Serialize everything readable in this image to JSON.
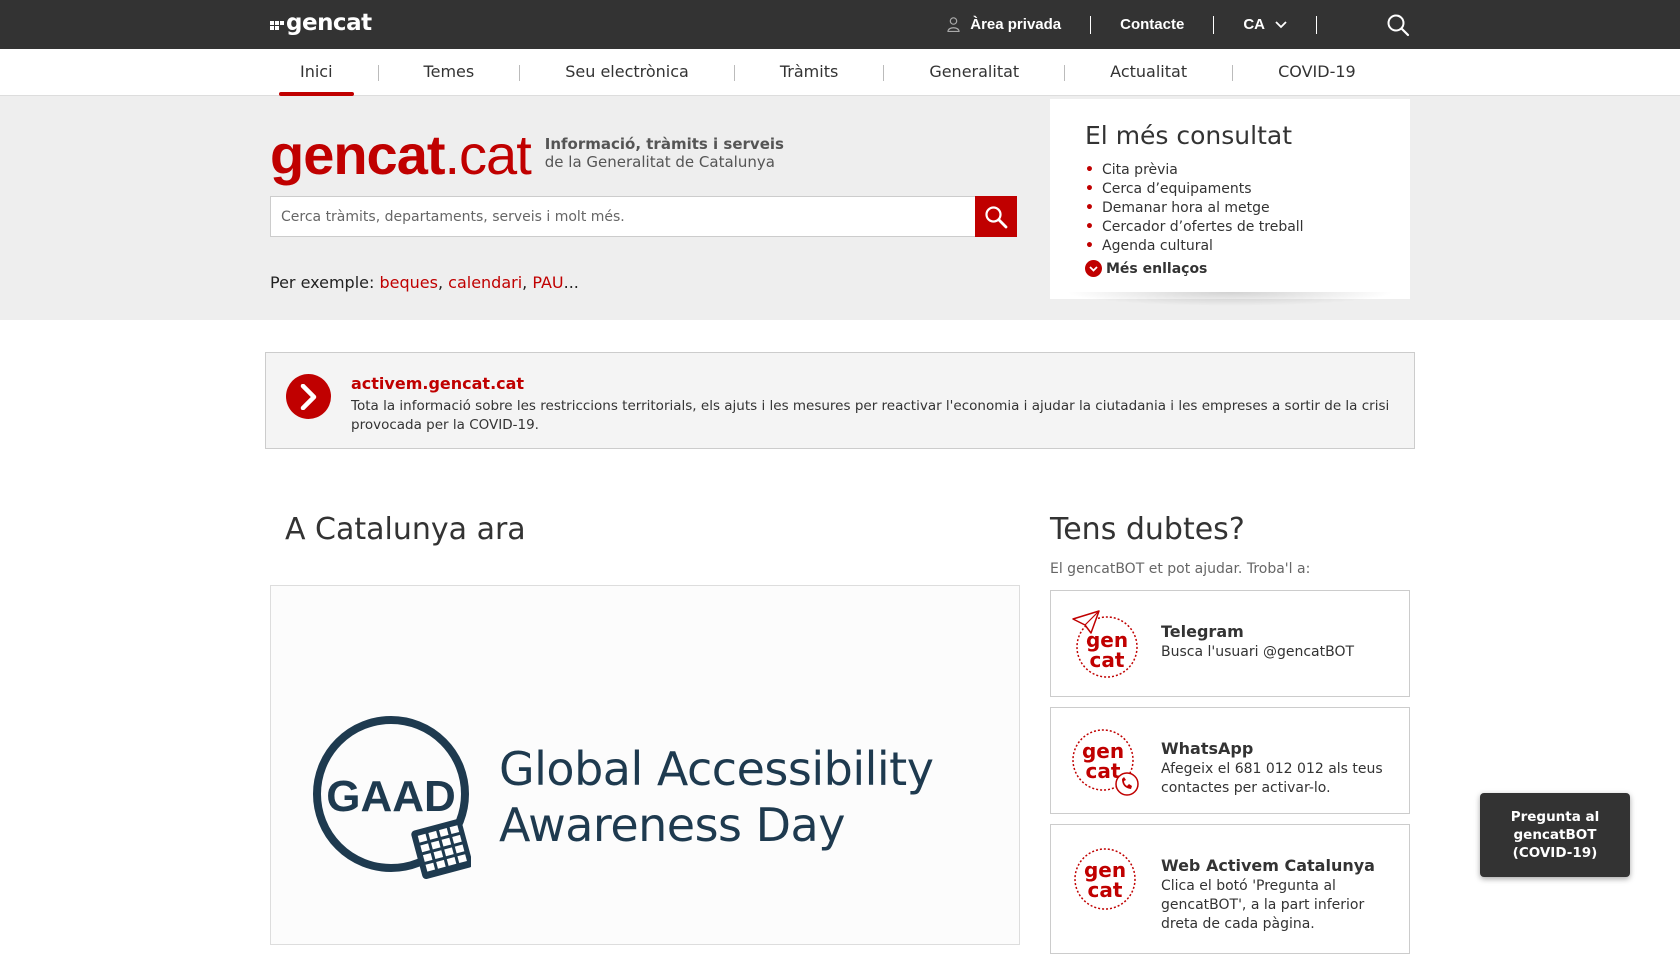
{
  "header": {
    "logo_text": "gencat",
    "private_area": "Àrea privada",
    "contact": "Contacte",
    "language": "CA"
  },
  "nav": {
    "items": [
      "Inici",
      "Temes",
      "Seu electrònica",
      "Tràmits",
      "Generalitat",
      "Actualitat",
      "COVID-19"
    ],
    "active": "Inici"
  },
  "hero": {
    "brand_bold": "gencat",
    "brand_light": ".cat",
    "subtitle_line1": "Informació, tràmits i serveis",
    "subtitle_line2": "de la Generalitat de Catalunya",
    "search_placeholder": "Cerca tràmits, departaments, serveis i molt més.",
    "examples_label": "Per exemple:",
    "examples": [
      "beques",
      "calendari",
      "PAU"
    ],
    "examples_suffix": "..."
  },
  "most_consulted": {
    "title": "El més consultat",
    "links": [
      "Cita prèvia",
      "Cerca d’equipaments",
      "Demanar hora al metge",
      "Cercador d’ofertes de treball",
      "Agenda cultural"
    ],
    "more": "Més enllaços"
  },
  "alert": {
    "title": "activem.gencat.cat",
    "text": "Tota la informació sobre les restriccions territorials, els ajuts i les mesures per reactivar l'economia i ajudar la ciutadania i les empreses a sortir de la crisi provocada per la COVID-19."
  },
  "catalunya_ara": {
    "title": "A Catalunya ara",
    "logo_text": "GAAD",
    "feature_line1": "Global Accessibility",
    "feature_line2": "Awareness Day"
  },
  "dubtes": {
    "title": "Tens dubtes?",
    "subtitle": "El gencatBOT et pot ajudar. Troba'l a:",
    "icon_text_1": "gen",
    "icon_text_2": "cat",
    "cards": [
      {
        "title": "Telegram",
        "text": "Busca l'usuari @gencatBOT",
        "icon": "telegram-bot-icon"
      },
      {
        "title": "WhatsApp",
        "text": "Afegeix el 681 012 012 als teus contactes per activar-lo.",
        "icon": "whatsapp-bot-icon"
      },
      {
        "title": "Web Activem Catalunya",
        "text": "Clica el botó 'Pregunta al gencatBOT', a la part inferior dreta de cada pàgina.",
        "icon": "web-bot-icon"
      }
    ]
  },
  "floating_button": "Pregunta al gencatBOT (COVID-19)",
  "colors": {
    "brand_red": "#c00000",
    "topbar": "#333333",
    "hero_bg": "#eeeeee",
    "gaad_blue": "#1e3a4f"
  }
}
